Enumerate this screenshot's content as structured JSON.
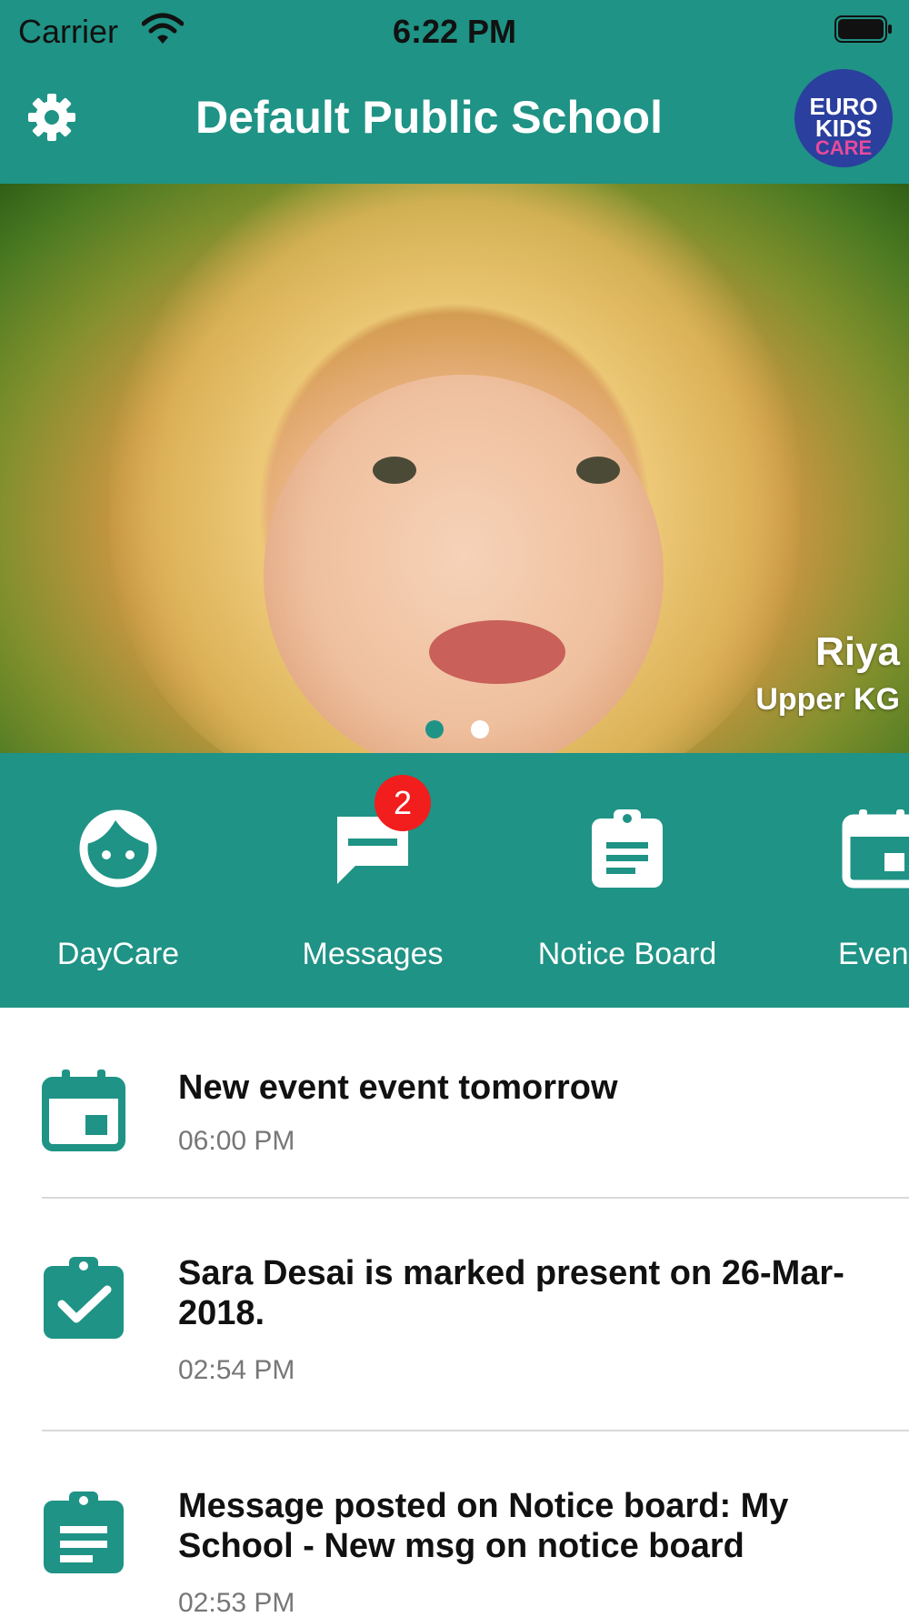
{
  "status_bar": {
    "carrier": "Carrier",
    "time": "6:22 PM"
  },
  "header": {
    "title": "Default Public School",
    "logo_lines": [
      "EURO",
      "KIDS",
      "CARE"
    ]
  },
  "hero": {
    "student_name": "Riya",
    "student_class": "Upper KG",
    "pages": 2,
    "active_page": 1
  },
  "quick_actions": [
    {
      "label": "DayCare",
      "icon": "child-face-icon"
    },
    {
      "label": "Messages",
      "icon": "message-icon",
      "badge": "2"
    },
    {
      "label": "Notice Board",
      "icon": "clipboard-icon"
    },
    {
      "label": "Even",
      "icon": "calendar-icon"
    }
  ],
  "feed": [
    {
      "text": "New event  event tomorrow",
      "time": "06:00 PM",
      "icon": "calendar-icon"
    },
    {
      "text": "Sara Desai is marked present on 26-Mar-2018.",
      "time": "02:54 PM",
      "icon": "attendance-check-icon"
    },
    {
      "text": "Message posted on Notice board: My School - New msg on notice board",
      "time": "02:53 PM",
      "icon": "clipboard-icon"
    }
  ],
  "colors": {
    "primary": "#1f9385",
    "badge": "#f21d1d",
    "logo_bg": "#2b3f9e",
    "logo_accent": "#e84a9a"
  }
}
